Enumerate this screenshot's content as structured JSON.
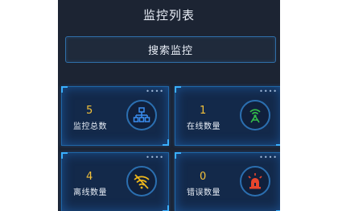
{
  "header": {
    "title": "监控列表"
  },
  "search": {
    "label": "搜索监控"
  },
  "cards": [
    {
      "value": "5",
      "label": "监控总数",
      "icon": "network-icon",
      "color": "#3a8ef0"
    },
    {
      "value": "1",
      "label": "在线数量",
      "icon": "signal-tower-icon",
      "color": "#35c04a"
    },
    {
      "value": "4",
      "label": "离线数量",
      "icon": "wifi-off-icon",
      "color": "#f0b81c"
    },
    {
      "value": "0",
      "label": "错误数量",
      "icon": "alarm-light-icon",
      "color": "#e8452c"
    }
  ],
  "colors": {
    "background": "#1c2433",
    "card_border": "#1f67a8",
    "value_text": "#f3c13a"
  }
}
